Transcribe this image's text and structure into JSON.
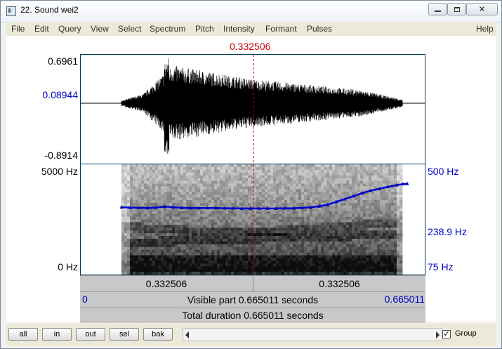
{
  "window": {
    "title": "22. Sound wei2"
  },
  "menu": [
    "File",
    "Edit",
    "Query",
    "View",
    "Select",
    "Spectrum",
    "Pitch",
    "Intensity",
    "Formant",
    "Pulses",
    "Help"
  ],
  "cursor": {
    "time": "0.332506"
  },
  "waveform": {
    "max_label": "0.6961",
    "min_label": "-0.8914",
    "cursor_amp_label": "0.08944"
  },
  "spectrogram": {
    "top_label": "5000 Hz",
    "bottom_label": "0 Hz"
  },
  "pitch": {
    "top_label": "500 Hz",
    "mid_label": "238.9 Hz",
    "bottom_label": "75 Hz",
    "track": [
      {
        "t": 0.0,
        "f": 236
      },
      {
        "t": 0.02,
        "f": 234
      },
      {
        "t": 0.04,
        "f": 233
      },
      {
        "t": 0.06,
        "f": 232
      },
      {
        "t": 0.08,
        "f": 234
      },
      {
        "t": 0.1,
        "f": 239
      },
      {
        "t": 0.12,
        "f": 236
      },
      {
        "t": 0.14,
        "f": 233
      },
      {
        "t": 0.16,
        "f": 232
      },
      {
        "t": 0.18,
        "f": 232
      },
      {
        "t": 0.2,
        "f": 232
      },
      {
        "t": 0.22,
        "f": 232
      },
      {
        "t": 0.24,
        "f": 231
      },
      {
        "t": 0.26,
        "f": 231
      },
      {
        "t": 0.28,
        "f": 230
      },
      {
        "t": 0.3,
        "f": 230
      },
      {
        "t": 0.32,
        "f": 230
      },
      {
        "t": 0.34,
        "f": 230
      },
      {
        "t": 0.36,
        "f": 230
      },
      {
        "t": 0.38,
        "f": 231
      },
      {
        "t": 0.4,
        "f": 231
      },
      {
        "t": 0.42,
        "f": 233
      },
      {
        "t": 0.44,
        "f": 235
      },
      {
        "t": 0.46,
        "f": 240
      },
      {
        "t": 0.48,
        "f": 248
      },
      {
        "t": 0.5,
        "f": 262
      },
      {
        "t": 0.52,
        "f": 276
      },
      {
        "t": 0.54,
        "f": 292
      },
      {
        "t": 0.56,
        "f": 310
      },
      {
        "t": 0.58,
        "f": 325
      },
      {
        "t": 0.6,
        "f": 338
      },
      {
        "t": 0.62,
        "f": 350
      },
      {
        "t": 0.64,
        "f": 362
      },
      {
        "t": 0.655,
        "f": 370
      },
      {
        "t": 0.665,
        "f": 372
      }
    ]
  },
  "selection": {
    "left_label": "0.332506",
    "right_label": "0.332506"
  },
  "visible": {
    "start": "0",
    "label": "Visible part 0.665011 seconds",
    "end": "0.665011"
  },
  "total": {
    "label": "Total duration 0.665011 seconds"
  },
  "nav": {
    "all": "all",
    "in": "in",
    "out": "out",
    "sel": "sel",
    "bak": "bak"
  },
  "group": {
    "label": "Group",
    "checked": true
  },
  "colors": {
    "cursor": "#cc0000",
    "pitch": "#0000c8",
    "frame": "#003a5a"
  }
}
